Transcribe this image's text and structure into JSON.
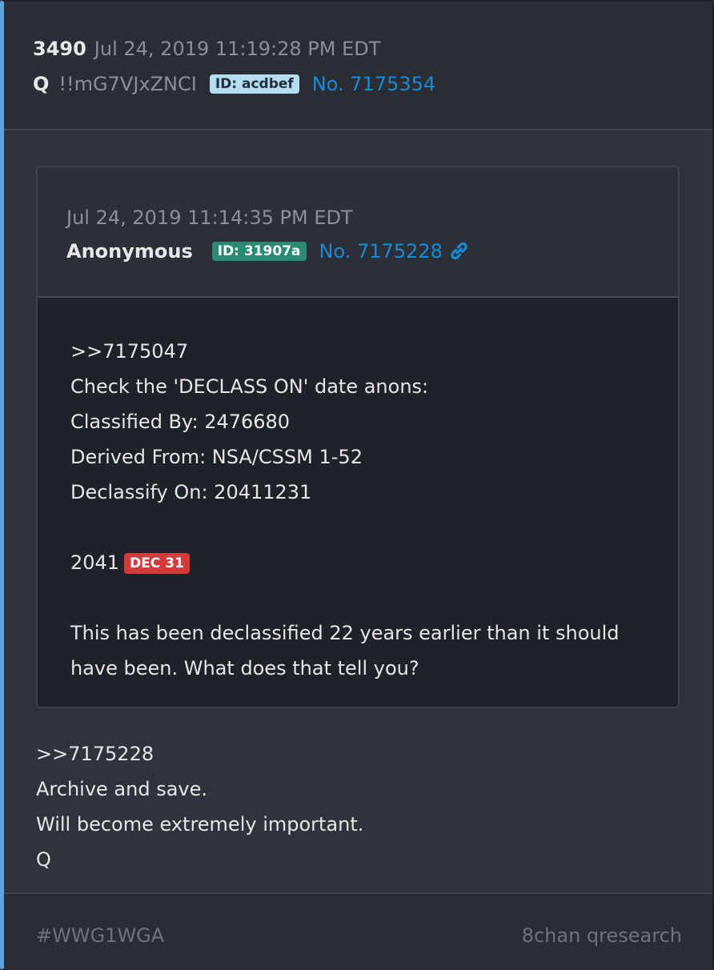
{
  "post": {
    "number": "3490",
    "date": "Jul 24, 2019 11:19:28 PM EDT",
    "name": "Q",
    "tripcode": "!!mG7VJxZNCI",
    "id_label": "ID: acdbef",
    "post_no": "No. 7175354"
  },
  "quoted": {
    "date": "Jul 24, 2019 11:14:35 PM EDT",
    "name": "Anonymous",
    "id_label": "ID: 31907a",
    "post_no": "No. 7175228",
    "link_icon": "link-icon",
    "lines": [
      ">>7175047",
      "Check the 'DECLASS ON' date anons:",
      "Classified By: 2476680",
      "Derived From: NSA/CSSM 1-52",
      "Declassify On: 20411231"
    ],
    "year": "2041",
    "date_badge": "DEC 31",
    "closing": "This has been declassified 22 years earlier than it should have been. What does that tell you?"
  },
  "reply": {
    "lines": [
      ">>7175228",
      "Archive and save.",
      "Will become extremely important.",
      "Q"
    ]
  },
  "footer": {
    "hashtag": "#WWG1WGA",
    "source": "8chan qresearch"
  },
  "colors": {
    "accent_bar": "#5fa2dd",
    "link": "#1a8ad4",
    "badge_q": "#b6dcf2",
    "badge_anon": "#2a8a72",
    "badge_date": "#d33a3a"
  }
}
